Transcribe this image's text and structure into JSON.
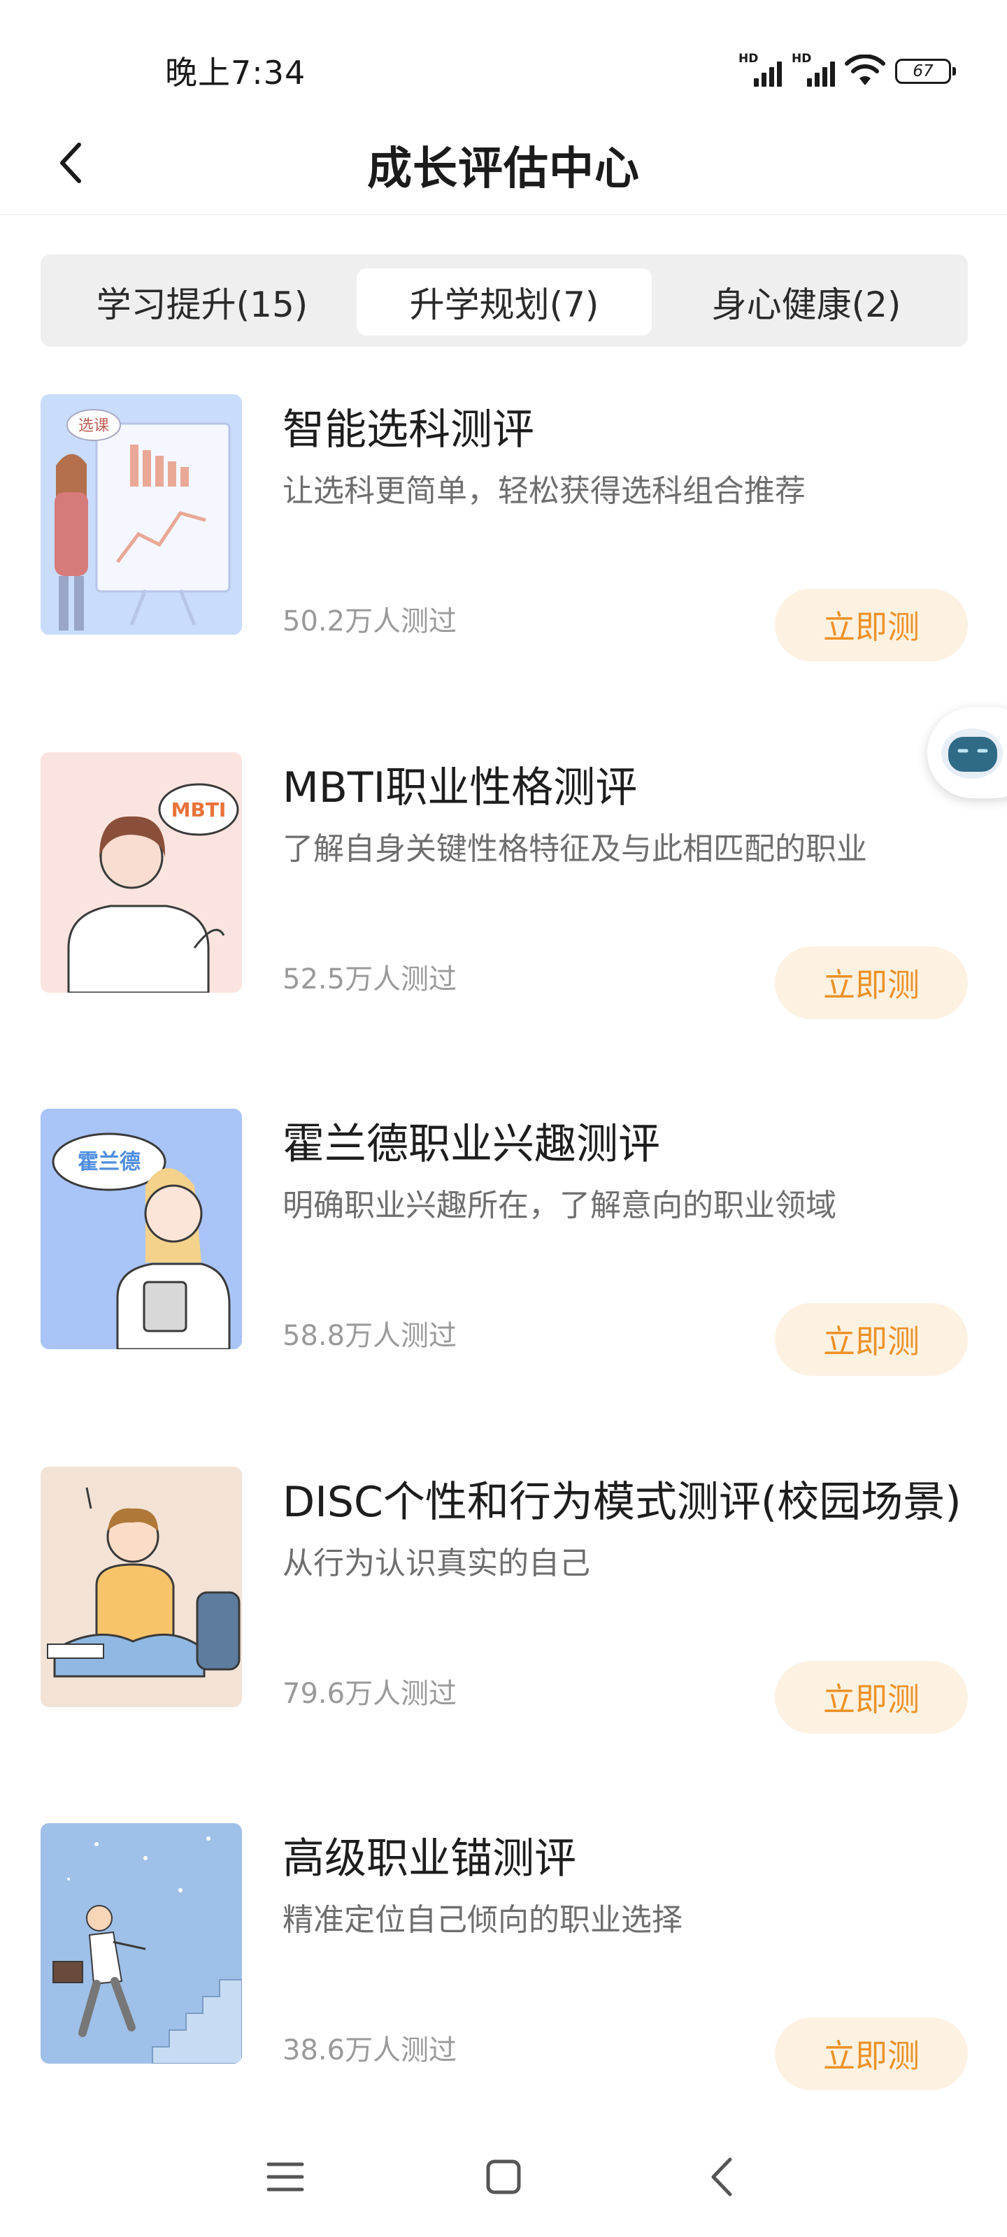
{
  "status_bar": {
    "time": "晚上7:34",
    "network_label_1": "HD",
    "network_label_2": "HD",
    "battery_level": "67"
  },
  "header": {
    "title": "成长评估中心",
    "back_icon": "chevron-left-icon"
  },
  "tabs": [
    {
      "label": "学习提升(15)",
      "active": false
    },
    {
      "label": "升学规划(7)",
      "active": true
    },
    {
      "label": "身心健康(2)",
      "active": false
    }
  ],
  "tests": [
    {
      "title": "智能选科测评",
      "description": "让选科更简单，轻松获得选科组合推荐",
      "count": "50.2万人测过",
      "button": "立即测",
      "image_label": "选课"
    },
    {
      "title": "MBTI职业性格测评",
      "description": "了解自身关键性格特征及与此相匹配的职业",
      "count": "52.5万人测过",
      "button": "立即测",
      "image_label": "MBTI"
    },
    {
      "title": "霍兰德职业兴趣测评",
      "description": "明确职业兴趣所在，了解意向的职业领域",
      "count": "58.8万人测过",
      "button": "立即测",
      "image_label": "霍兰德"
    },
    {
      "title": "DISC个性和行为模式测评(校园场景)",
      "description": "从行为认识真实的自己",
      "count": "79.6万人测过",
      "button": "立即测",
      "image_label": ""
    },
    {
      "title": "高级职业锚测评",
      "description": "精准定位自己倾向的职业选择",
      "count": "38.6万人测过",
      "button": "立即测",
      "image_label": ""
    }
  ],
  "colors": {
    "accent_orange": "#ee9127",
    "button_bg": "#fdf1e2",
    "tab_bg": "#efefef"
  }
}
